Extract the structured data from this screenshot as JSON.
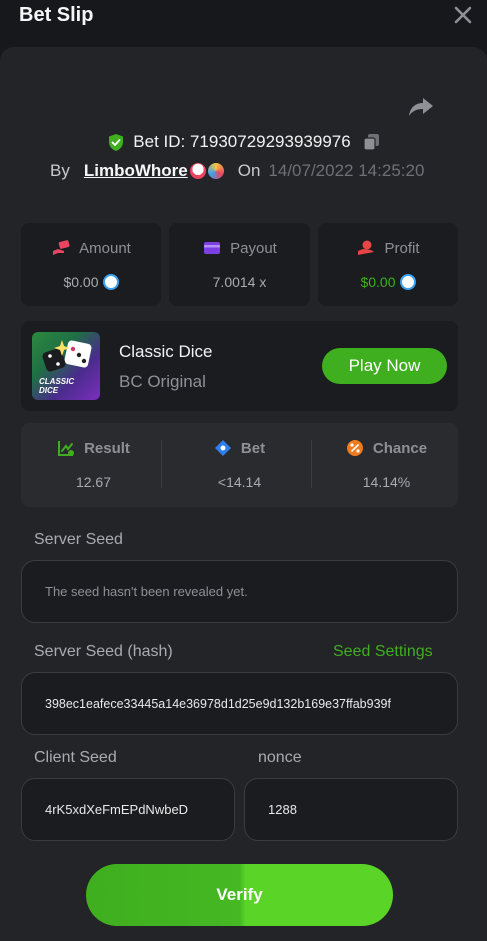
{
  "header": {
    "title": "Bet Slip"
  },
  "bet": {
    "id_text": "Bet ID: 71930729293939976",
    "by_label": "By",
    "username": "LimboWhore",
    "on_label": "On",
    "date": "14/07/2022 14:25:20"
  },
  "stats": [
    {
      "label": "Amount",
      "value": "$0.00",
      "icon": "money-hand-icon",
      "color": "#e94560",
      "value_color": "#a9abb0",
      "has_coin": true
    },
    {
      "label": "Payout",
      "value": "7.0014 x",
      "icon": "wallet-icon",
      "color": "#7b3fe4",
      "value_color": "#a9abb0",
      "has_coin": false
    },
    {
      "label": "Profit",
      "value": "$0.00",
      "icon": "profit-hand-icon",
      "color": "#e94545",
      "value_color": "#3fae1f",
      "has_coin": true
    }
  ],
  "game": {
    "name": "Classic Dice",
    "provider": "BC Original",
    "thumb_text": "CLASSIC DICE",
    "play_label": "Play Now"
  },
  "result": [
    {
      "label": "Result",
      "value": "12.67",
      "icon": "result-chart-icon",
      "color": "#3fae1f"
    },
    {
      "label": "Bet",
      "value": "<14.14",
      "icon": "bet-tag-icon",
      "color": "#2f7fe8"
    },
    {
      "label": "Chance",
      "value": "14.14%",
      "icon": "percent-icon",
      "color": "#f07b1f"
    }
  ],
  "server_seed": {
    "label": "Server Seed",
    "value": "The seed hasn't been revealed yet."
  },
  "server_seed_hash": {
    "label": "Server Seed (hash)",
    "settings_label": "Seed Settings",
    "value": "398ec1eafece33445a14e36978d1d25e9d132b169e37ffab939f"
  },
  "client_seed": {
    "label": "Client Seed",
    "value": "4rK5xdXeFmEPdNwbeD"
  },
  "nonce": {
    "label": "nonce",
    "value": "1288"
  },
  "verify_label": "Verify",
  "colors": {
    "accent_green": "#3fae1f",
    "bg": "#17181b",
    "panel": "#232427"
  }
}
